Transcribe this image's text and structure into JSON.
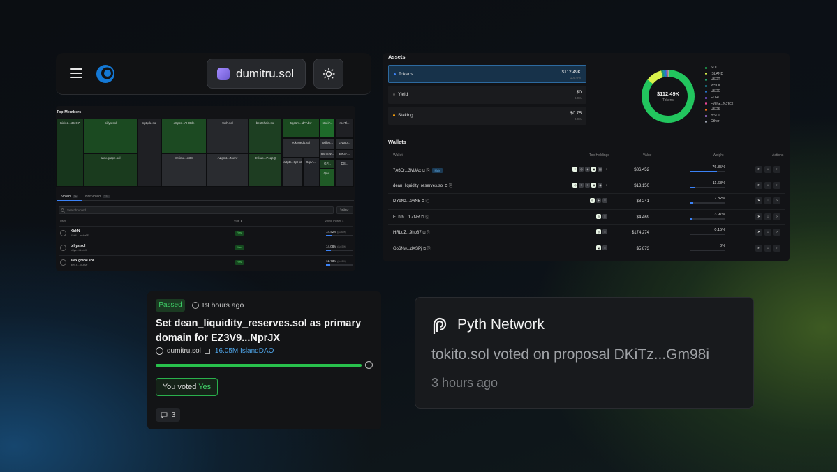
{
  "header": {
    "wallet_label": "dumitru.sol"
  },
  "treemap": {
    "title": "Top Members",
    "cells": [
      "KirkN...xDzS7",
      "billys.sol",
      "nptyde.sol",
      "JCpcr...AHDdn",
      "tsch.sol",
      "bestchain.sol",
      "5qc1m...dFAbw",
      "6KeiF...",
      "roeTl...",
      "alex.grape.sol",
      "8Ktimu...nt68",
      "AZgmt...Zoenr",
      "8Kkuo...PcqbQ",
      "ecknoeds.sol",
      "Ddf9n...",
      "crypto...",
      "8ShSW...",
      "Bw37...",
      "GP...",
      "Fa8pB...9pHxH",
      "9qnA...",
      "Qrv...",
      "DS..."
    ],
    "tabs": {
      "voted": "Voted",
      "voted_count": "3k",
      "not_voted": "Not Voted",
      "not_voted_count": "721"
    },
    "search_placeholder": "Search Voted...",
    "filter": "Filter",
    "columns": {
      "user": "User",
      "vote": "Vote ⬍",
      "power": "Voting Power ⬍"
    },
    "rows": [
      {
        "name": "KirkN",
        "sub": "Kirk4L...nHw6F",
        "vote": "Yes",
        "power": "14.42M",
        "pct": "(8.89%)",
        "fill": 0.2
      },
      {
        "name": "billys.sol",
        "sub": "billys...bLwbX",
        "vote": "Yes",
        "power": "14.08M",
        "pct": "(8.67%)",
        "fill": 0.19
      },
      {
        "name": "alex.grape.sol",
        "sub": "alex.b...2KeMf",
        "vote": "Yes",
        "power": "12.73M",
        "pct": "(6.49%)",
        "fill": 0.17
      }
    ]
  },
  "assets": {
    "title": "Assets",
    "rows": [
      {
        "label": "Tokens",
        "value": "$112.49K",
        "pct": "100.0%",
        "color": "#3b82f6"
      },
      {
        "label": "Yield",
        "value": "$0",
        "pct": "0.0%",
        "color": "#555555"
      },
      {
        "label": "Staking",
        "value": "$0.75",
        "pct": "0.0%",
        "color": "#f59e0b"
      }
    ],
    "donut_value": "$112.49K",
    "donut_label": "Tokens",
    "legend": [
      {
        "label": "SOL",
        "color": "#22c55e",
        "share": 0.86
      },
      {
        "label": "ISLAND",
        "color": "#d9f24b",
        "share": 0.1
      },
      {
        "label": "USDT",
        "color": "#22a06b",
        "share": 0.01
      },
      {
        "label": "WSOL",
        "color": "#1e90a6",
        "share": 0.01
      },
      {
        "label": "USDC",
        "color": "#2775ca",
        "share": 0.01
      },
      {
        "label": "EURC",
        "color": "#8b5cf6",
        "share": 0.004
      },
      {
        "label": "FyeiG...N3Ycx",
        "color": "#ec4899",
        "share": 0.003
      },
      {
        "label": "USDS",
        "color": "#f97316",
        "share": 0.002
      },
      {
        "label": "mSOL",
        "color": "#c084fc",
        "share": 0.001
      },
      {
        "label": "Other",
        "color": "#9ca3af",
        "share": 0.01
      }
    ]
  },
  "wallets": {
    "title": "Wallets",
    "columns": {
      "wallet": "Wallet",
      "holdings": "Top Holdings",
      "value": "Value",
      "weight": "Weight",
      "actions": "Actions"
    },
    "main_tag": "Main",
    "rows": [
      {
        "name": "7A6Cr...3MJAx",
        "main": true,
        "holdings": [
          "≡",
          "◎",
          "◈",
          "▣",
          "▤"
        ],
        "extra": "+3",
        "value": "$86,452",
        "weight": "76.85%",
        "fill": 0.7685
      },
      {
        "name": "dean_liquidity_reserves.sol",
        "main": false,
        "holdings": [
          "◎",
          "≡",
          "≡",
          "◉",
          "◉"
        ],
        "extra": "+1",
        "value": "$13,150",
        "weight": "11.68%",
        "fill": 0.1168
      },
      {
        "name": "DY9Nz...cviN5",
        "main": false,
        "holdings": [
          "◎",
          "◈",
          "≡"
        ],
        "extra": "",
        "value": "$8,241",
        "weight": "7.32%",
        "fill": 0.0732
      },
      {
        "name": "FThth...rLZNR",
        "main": false,
        "holdings": [
          "◎",
          "≡"
        ],
        "extra": "",
        "value": "$4,469",
        "weight": "3.97%",
        "fill": 0.0397
      },
      {
        "name": "HRLdZ...9ho87",
        "main": false,
        "holdings": [
          "◎",
          "≡"
        ],
        "extra": "",
        "value": "$174.274",
        "weight": "0.15%",
        "fill": 0.0015
      },
      {
        "name": "Go6Nw...dXSPj",
        "main": false,
        "holdings": [
          "▣",
          "≡"
        ],
        "extra": "",
        "value": "$5.873",
        "weight": "0%",
        "fill": 0
      }
    ]
  },
  "proposal": {
    "status": "Passed",
    "time": "19 hours ago",
    "title": "Set dean_liquidity_reserves.sol as primary domain for EZ3V9...NprJX",
    "author": "dumitru.sol",
    "dao": "16.05M IslandDAO",
    "progress": 1.0,
    "voted_prefix": "You voted",
    "voted_choice": "Yes",
    "comments": "3"
  },
  "notification": {
    "title": "Pyth Network",
    "message": "tokito.sol voted on proposal DKiTz...Gm98i",
    "time": "3 hours ago"
  }
}
